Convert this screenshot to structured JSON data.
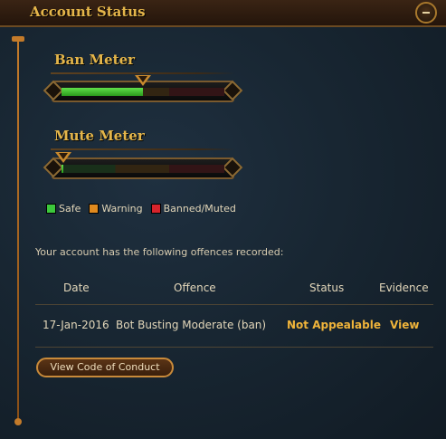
{
  "window": {
    "title": "Account Status"
  },
  "ban_meter": {
    "label": "Ban Meter",
    "level_percent": 50
  },
  "mute_meter": {
    "label": "Mute Meter",
    "level_percent": 1
  },
  "legend": {
    "items": [
      {
        "label": "Safe",
        "color": "#3cc83c"
      },
      {
        "label": "Warning",
        "color": "#e08a1e"
      },
      {
        "label": "Banned/Muted",
        "color": "#d8242c"
      }
    ]
  },
  "offences": {
    "intro": "Your account has the following offences recorded:",
    "headers": {
      "date": "Date",
      "offence": "Offence",
      "status": "Status",
      "evidence": "Evidence"
    },
    "rows": [
      {
        "date": "17-Jan-2016",
        "offence": "Bot Busting Moderate (ban)",
        "status": "Not Appealable",
        "evidence": "View"
      }
    ]
  },
  "conduct_button": {
    "label": "View Code of Conduct"
  },
  "colors": {
    "accent_gold": "#e5b64a",
    "link_gold": "#f0b43a"
  }
}
